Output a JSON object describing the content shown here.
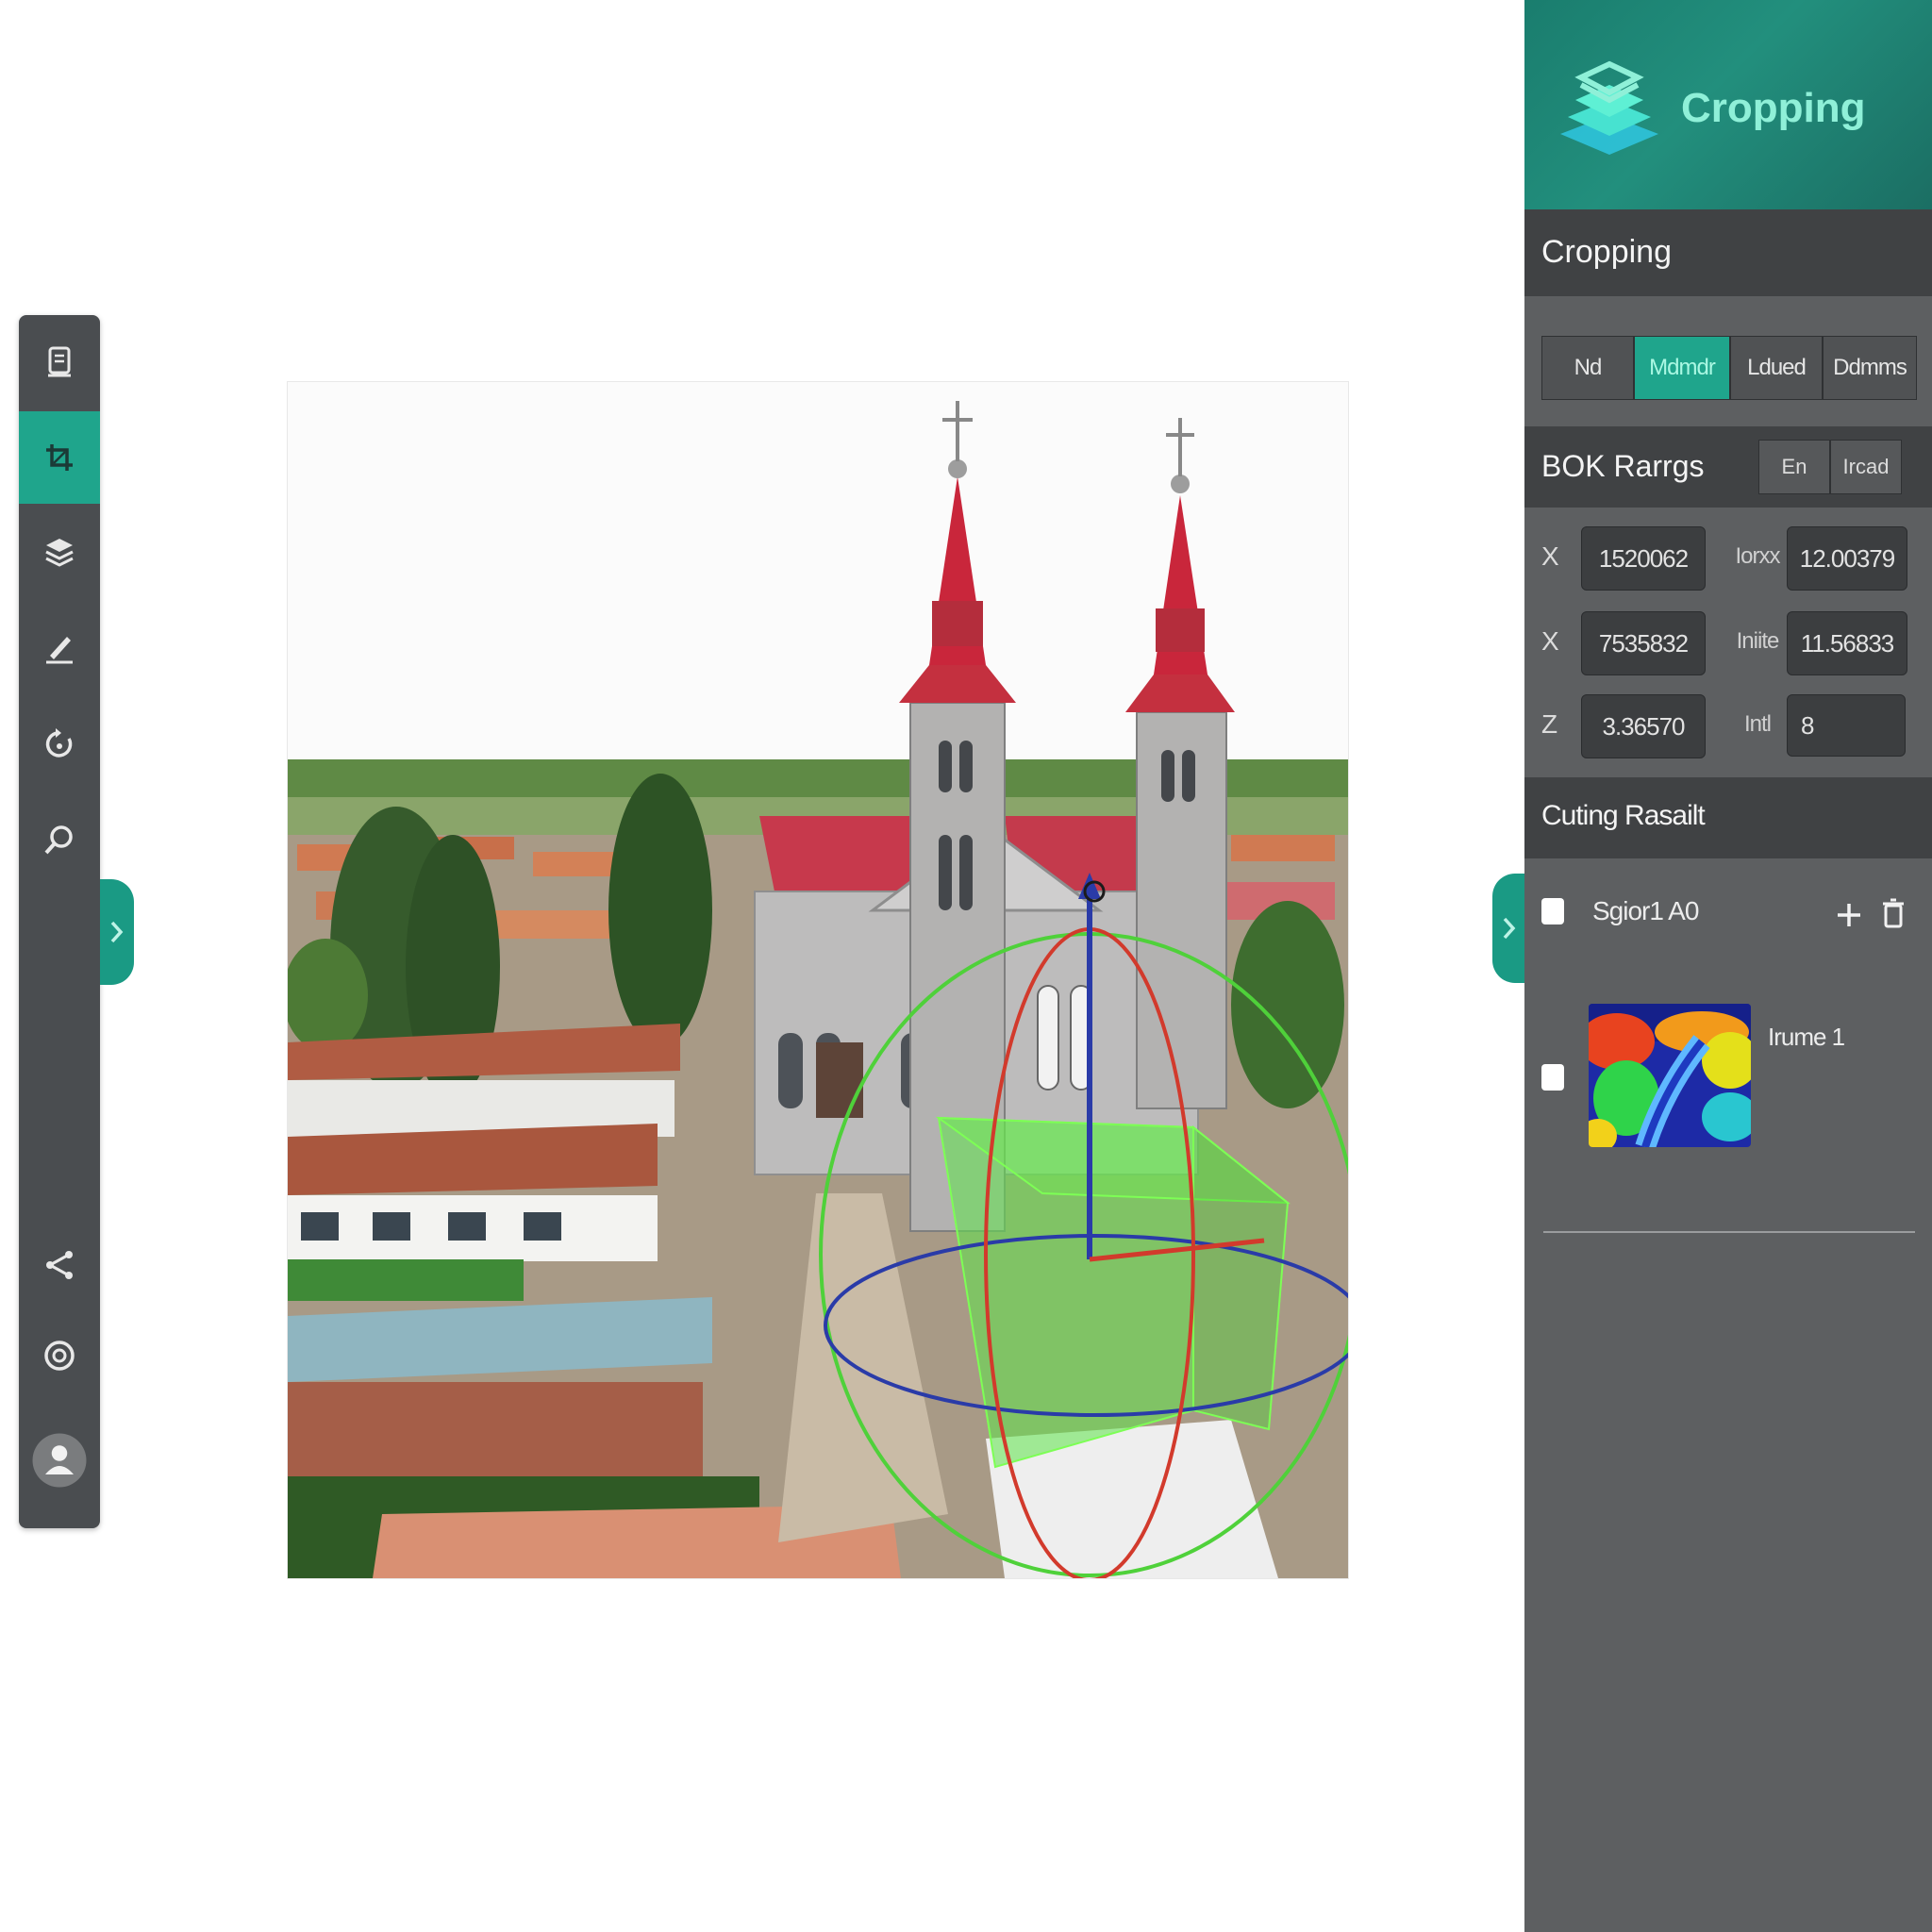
{
  "panel": {
    "header_title": "Cropping",
    "section_title": "Cropping",
    "modes": [
      "Nd",
      "Mdmdr",
      "Ldued",
      "Ddmms"
    ],
    "active_mode": "Mdmdr",
    "box_range": {
      "title": "BOK Rarrgs",
      "buttons": [
        "En",
        "Ircad"
      ],
      "rows": [
        {
          "axis": "X",
          "value": "1520062",
          "label": "Iorxx",
          "value2": "12.00379"
        },
        {
          "axis": "X",
          "value": "7535832",
          "label": "Iniite",
          "value2": "11.56833"
        },
        {
          "axis": "Z",
          "value": "3.36570",
          "label": "Intl",
          "value2": "8"
        }
      ]
    },
    "result": {
      "title": "Cuting Rasailt",
      "item1_label": "Sgior1 A0",
      "item2_label": "Irume 1"
    }
  },
  "colors": {
    "accent": "#1fa58c",
    "panel_bg": "#5d5f61",
    "toolbar_bg": "#4a4d50",
    "gizmo_x": "#d23a2c",
    "gizmo_y": "#2a3ba8",
    "gizmo_z": "#4fd13a",
    "crop_box": "#6cf04e"
  },
  "toolbar": {
    "icons": [
      "document-icon",
      "crop-icon",
      "layers-icon",
      "measure-icon",
      "rotate-icon",
      "search-icon",
      "share-icon",
      "settings-icon",
      "user-avatar-icon"
    ],
    "active": "crop-icon"
  }
}
